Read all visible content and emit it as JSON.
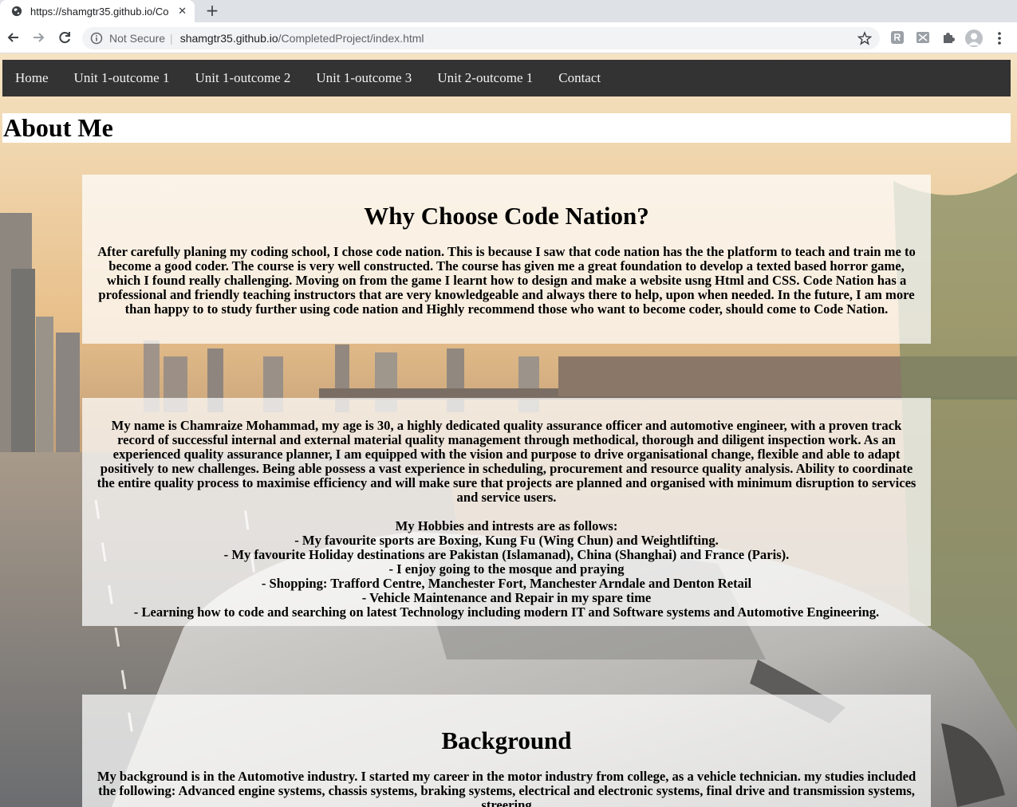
{
  "browser": {
    "tab_title": "https://shamgtr35.github.io/Co",
    "url_security": "Not Secure",
    "url_host": "shamgtr35.github.io",
    "url_path": "/CompletedProject/index.html"
  },
  "nav": {
    "items": [
      "Home",
      "Unit 1-outcome 1",
      "Unit 1-outcome 2",
      "Unit 1-outcome 3",
      "Unit 2-outcome 1",
      "Contact"
    ]
  },
  "page_title": "About Me",
  "why": {
    "heading": "Why Choose Code Nation?",
    "body": "After carefully planing my coding school, I chose code nation. This is because I saw that code nation has the the platform to teach and train me to become a good coder. The course is very well constructed. The course has given me a great foundation to develop a texted based horror game, which I found really challenging. Moving on from the game I learnt how to design and make a website usng Html and CSS. Code Nation has a professional and friendly teaching instructors that are very knowledgeable and always there to help, upon when needed. In the future, I am more than happy to to study further using code nation and Highly recommend those who want to become coder, should come to Code Nation."
  },
  "me": {
    "intro": "My name is Chamraize Mohammad, my age is 30, a highly dedicated quality assurance officer and automotive engineer, with a proven track record of successful internal and external material quality management through methodical, thorough and diligent inspection work. As an experienced quality assurance planner, I am equipped with the vision and purpose to drive organisational change, flexible and able to adapt positively to new challenges. Being able possess a vast experience in scheduling, procurement and resource quality analysis. Ability to coordinate the entire quality process to maximise efficiency and will make sure that projects are planned and organised with minimum disruption to services and service users.",
    "hobbies_heading": "My Hobbies and intrests are as follows:",
    "hobbies": [
      "- My favourite sports are Boxing, Kung Fu (Wing Chun) and Weightlifting.",
      "- My favourite Holiday destinations are Pakistan (Islamanad), China (Shanghai) and France (Paris).",
      "- I enjoy going to the mosque and praying",
      "- Shopping: Trafford Centre, Manchester Fort, Manchester Arndale and Denton Retail",
      "- Vehicle Maintenance and Repair in my spare time",
      "- Learning how to code and searching on latest Technology including modern IT and Software systems and Automotive Engineering."
    ]
  },
  "background": {
    "heading": "Background",
    "body": "My background is in the Automotive industry. I started my career in the motor industry from college, as a vehicle technician. my studies included the following: Advanced engine systems, chassis systems, braking systems, electrical and electronic systems, final drive and transmission systems, streering"
  }
}
